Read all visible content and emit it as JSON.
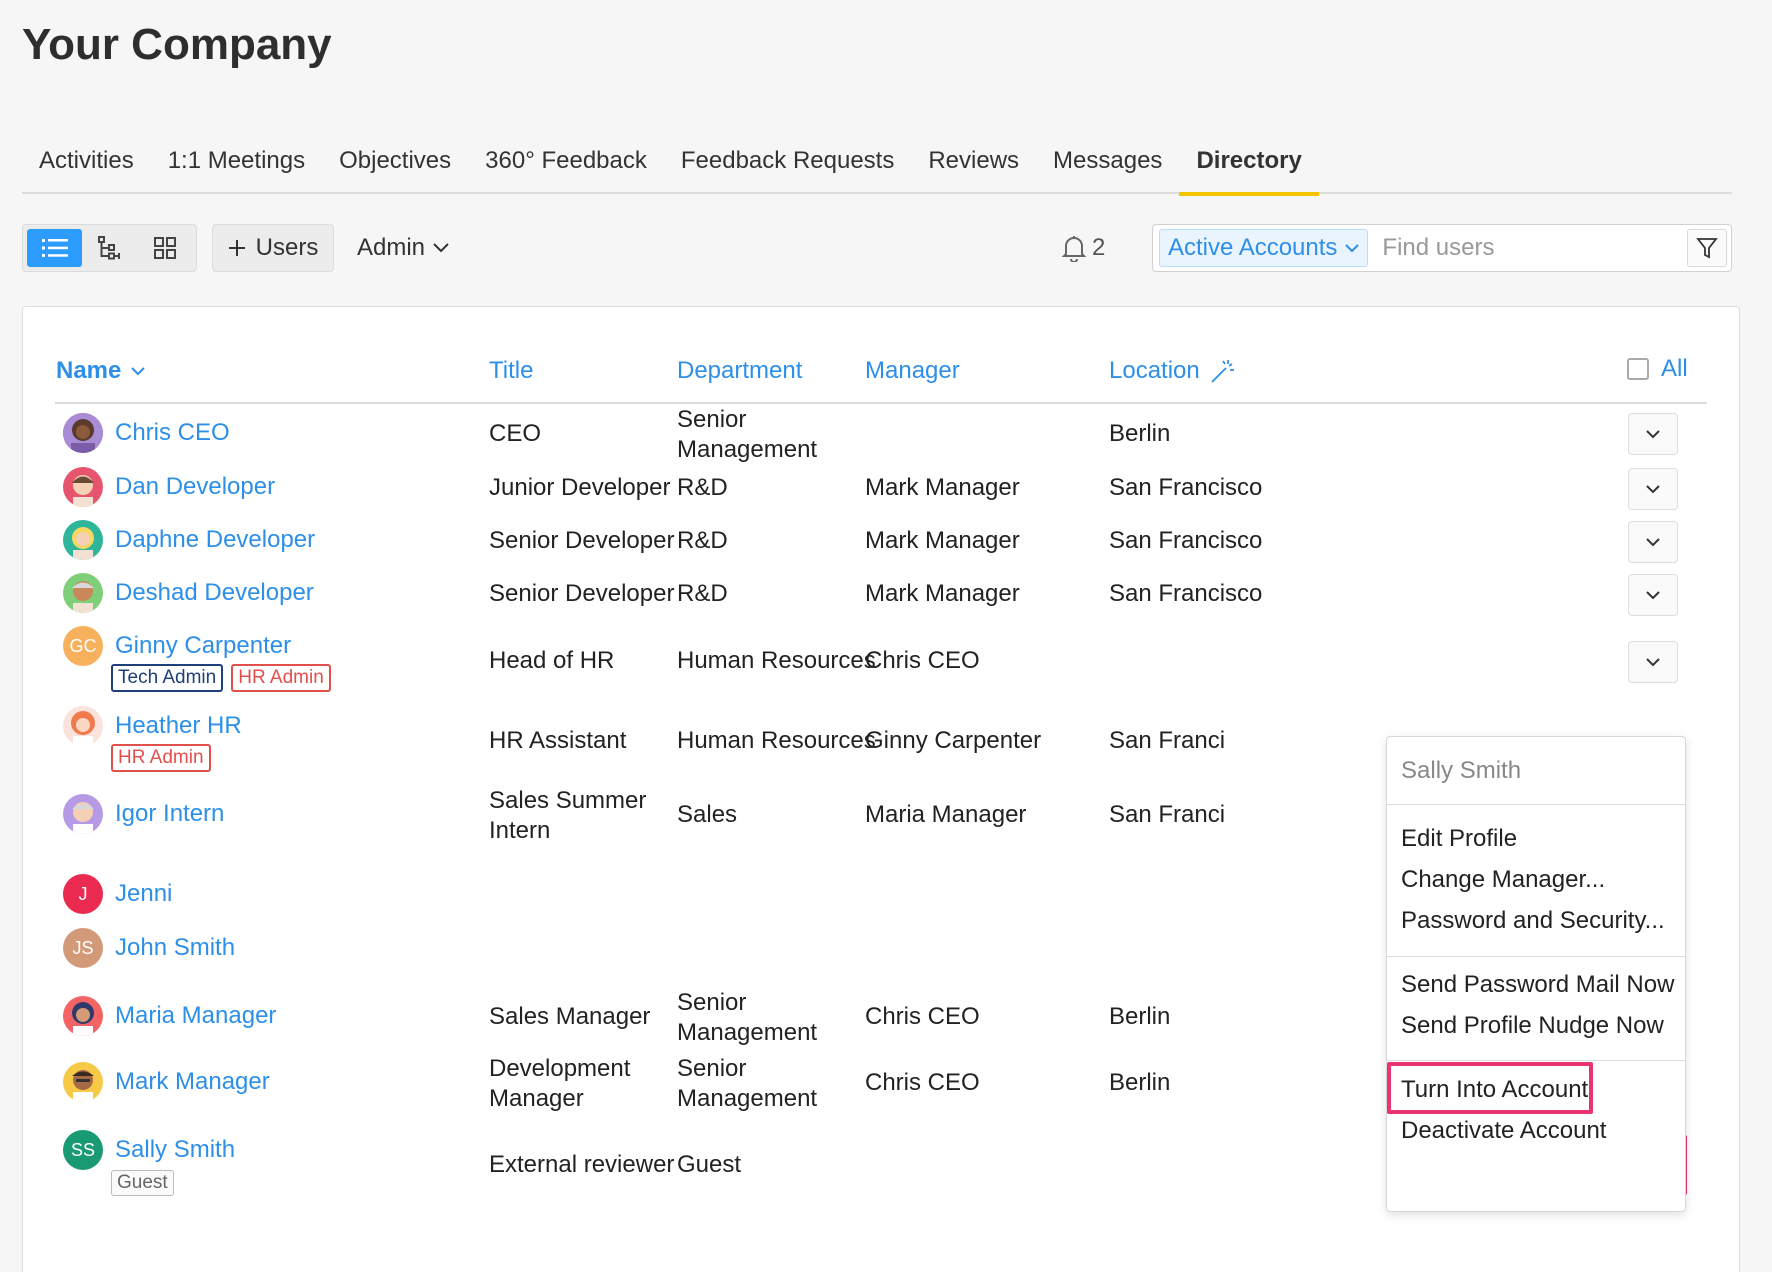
{
  "page": {
    "title": "Your Company"
  },
  "nav": {
    "tabs": [
      "Activities",
      "1:1 Meetings",
      "Objectives",
      "360° Feedback",
      "Feedback Requests",
      "Reviews",
      "Messages",
      "Directory"
    ],
    "active": "Directory"
  },
  "toolbar": {
    "view_modes": [
      {
        "icon": "list-view-icon",
        "active": true
      },
      {
        "icon": "org-chart-icon",
        "active": false
      },
      {
        "icon": "grid-view-icon",
        "active": false
      }
    ],
    "add_users_label": "Users",
    "admin_label": "Admin",
    "notification_count": "2",
    "status_filter": "Active Accounts",
    "search_placeholder": "Find users"
  },
  "table": {
    "columns": {
      "name": "Name",
      "title": "Title",
      "department": "Department",
      "manager": "Manager",
      "location": "Location",
      "all": "All"
    },
    "rows": [
      {
        "name": "Chris CEO",
        "title": "CEO",
        "department": "Senior Management",
        "manager": "",
        "location": "Berlin"
      },
      {
        "name": "Dan Developer",
        "title": "Junior Developer",
        "department": "R&D",
        "manager": "Mark Manager",
        "location": "San Francisco"
      },
      {
        "name": "Daphne Developer",
        "title": "Senior Developer",
        "department": "R&D",
        "manager": "Mark Manager",
        "location": "San Francisco"
      },
      {
        "name": "Deshad Developer",
        "title": "Senior Developer",
        "department": "R&D",
        "manager": "Mark Manager",
        "location": "San Francisco"
      },
      {
        "name": "Ginny Carpenter",
        "initials": "GC",
        "badges": [
          "Tech Admin",
          "HR Admin"
        ],
        "title": "Head of HR",
        "department": "Human Resources",
        "manager": "Chris CEO",
        "location": ""
      },
      {
        "name": "Heather HR",
        "badges": [
          "HR Admin"
        ],
        "title": "HR Assistant",
        "department": "Human Resources",
        "manager": "Ginny Carpenter",
        "location": "San Franci"
      },
      {
        "name": "Igor Intern",
        "title": "Sales Summer Intern",
        "department": "Sales",
        "manager": "Maria Manager",
        "location": "San Franci"
      },
      {
        "name": "Jenni",
        "initials": "J",
        "title": "",
        "department": "",
        "manager": "",
        "location": ""
      },
      {
        "name": "John Smith",
        "initials": "JS",
        "title": "",
        "department": "",
        "manager": "",
        "location": ""
      },
      {
        "name": "Maria Manager",
        "title": "Sales Manager",
        "department": "Senior Management",
        "manager": "Chris CEO",
        "location": "Berlin"
      },
      {
        "name": "Mark Manager",
        "title": "Development Manager",
        "department": "Senior Management",
        "manager": "Chris CEO",
        "location": "Berlin"
      },
      {
        "name": "Sally Smith",
        "initials": "SS",
        "badges": [
          "Guest"
        ],
        "title": "External reviewer",
        "department": "Guest",
        "manager": "",
        "location": ""
      }
    ]
  },
  "dropdown": {
    "header": "Sally Smith",
    "group1": [
      "Edit Profile",
      "Change Manager...",
      "Password and Security..."
    ],
    "group2": [
      "Send Password Mail Now",
      "Send Profile Nudge Now"
    ],
    "group3": [
      "Turn Into Account",
      "Deactivate Account"
    ]
  },
  "colors": {
    "link_blue": "#2d8fe8",
    "tab_underline": "#f2c500",
    "highlight_pink": "#ea3471",
    "avatar_gc": "#f7b05b",
    "avatar_j": "#ea2b4f",
    "avatar_js": "#d39a7a",
    "avatar_ss": "#1a9a72"
  }
}
